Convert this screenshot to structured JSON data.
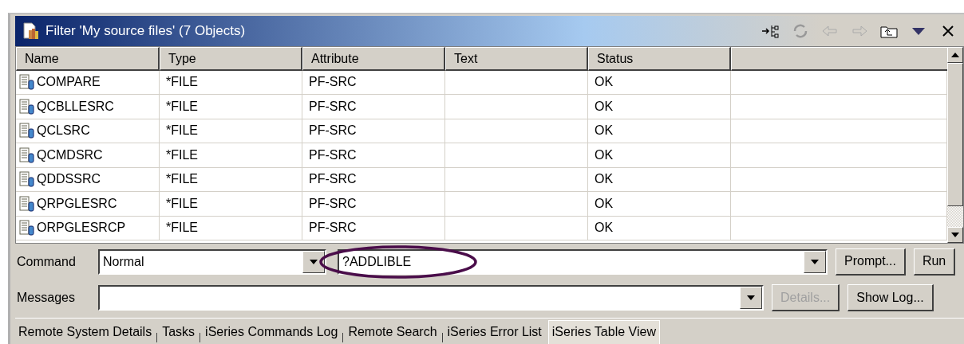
{
  "window": {
    "title": "Filter 'My source files' (7 Objects)"
  },
  "table": {
    "columns": [
      "Name",
      "Type",
      "Attribute",
      "Text",
      "Status"
    ],
    "rows": [
      {
        "name": "COMPARE",
        "type": "*FILE",
        "attribute": "PF-SRC",
        "status": "OK"
      },
      {
        "name": "QCBLLESRC",
        "type": "*FILE",
        "attribute": "PF-SRC",
        "status": "OK"
      },
      {
        "name": "QCLSRC",
        "type": "*FILE",
        "attribute": "PF-SRC",
        "status": "OK"
      },
      {
        "name": "QCMDSRC",
        "type": "*FILE",
        "attribute": "PF-SRC",
        "status": "OK"
      },
      {
        "name": "QDDSSRC",
        "type": "*FILE",
        "attribute": "PF-SRC",
        "status": "OK"
      },
      {
        "name": "QRPGLESRC",
        "type": "*FILE",
        "attribute": "PF-SRC",
        "status": "OK"
      },
      {
        "name": "ORPGLESRCP",
        "type": "*FILE",
        "attribute": "PF-SRC",
        "status": "OK"
      }
    ]
  },
  "command": {
    "label": "Command",
    "mode": "Normal",
    "value": "?ADDLIBLE",
    "buttons": [
      {
        "label": "Prompt...",
        "disabled": false
      },
      {
        "label": "Run",
        "disabled": false
      }
    ]
  },
  "messages": {
    "label": "Messages",
    "buttons": [
      {
        "label": "Details...",
        "disabled": true
      },
      {
        "label": "Show Log...",
        "disabled": false
      }
    ]
  },
  "tabs": [
    {
      "label": "Remote System Details",
      "selected": false
    },
    {
      "label": "Tasks",
      "selected": false
    },
    {
      "label": "iSeries Commands Log",
      "selected": false
    },
    {
      "label": "Remote Search",
      "selected": false
    },
    {
      "label": "iSeries Error List",
      "selected": false
    },
    {
      "label": "iSeries Table View",
      "selected": true
    }
  ]
}
